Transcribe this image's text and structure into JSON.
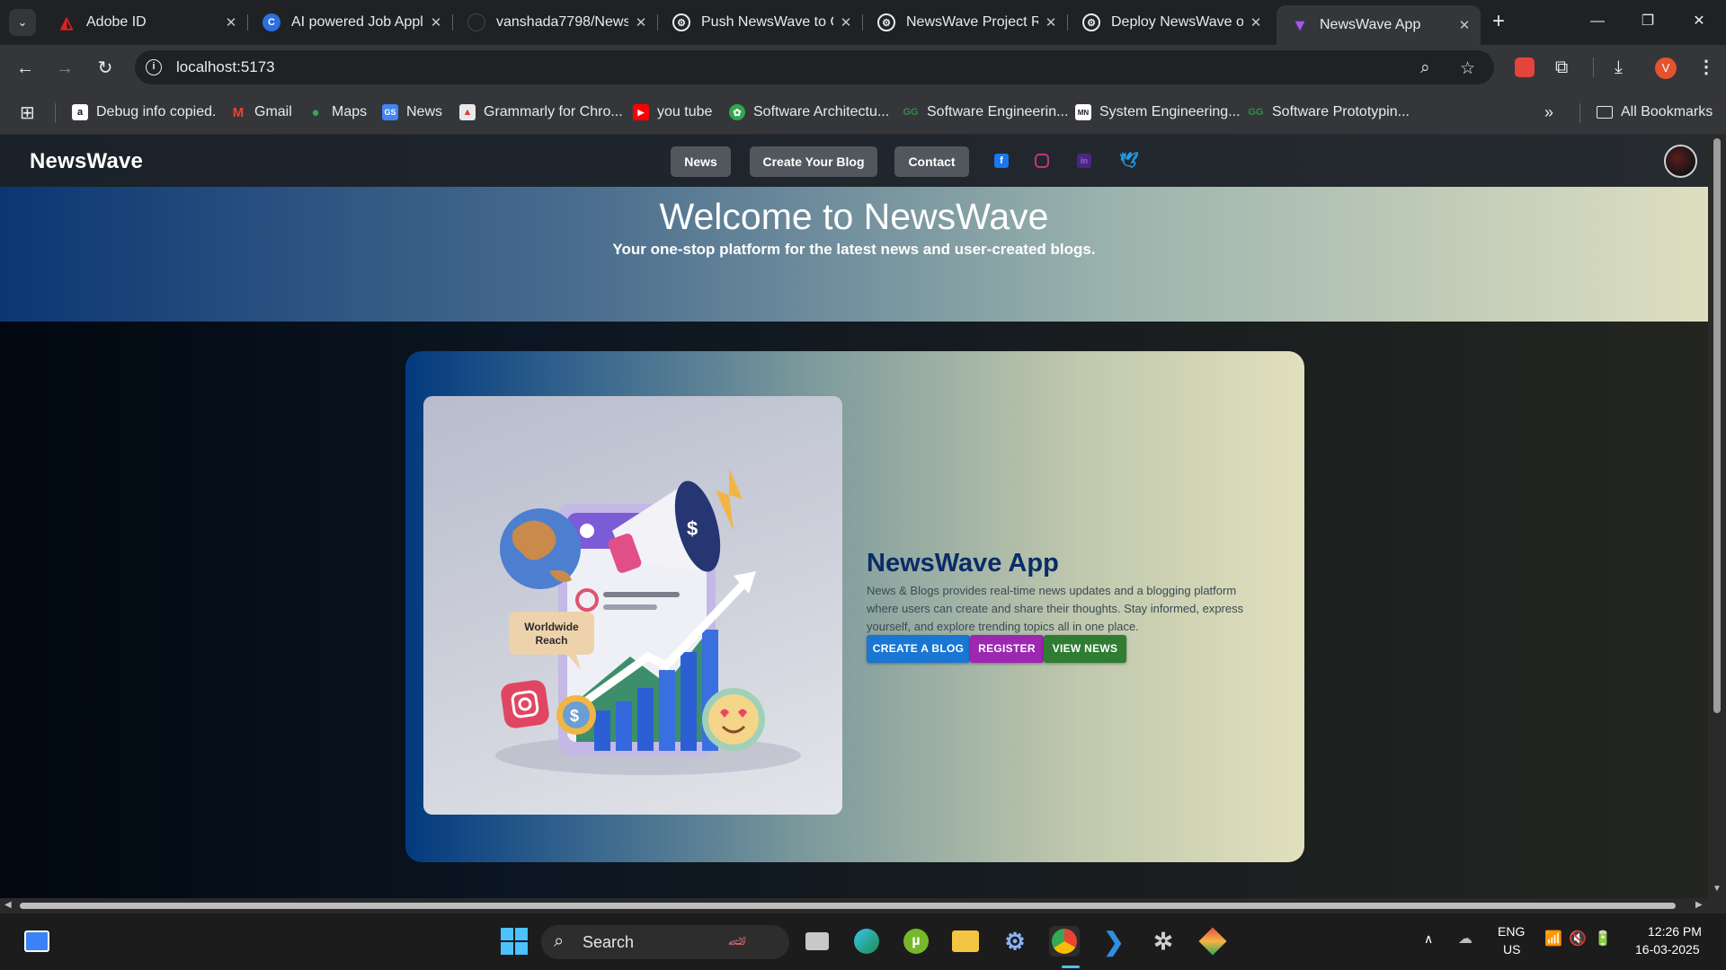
{
  "browser": {
    "tabs": [
      {
        "title": "Adobe ID",
        "icon": "adobe-icon",
        "color": "#e0211f"
      },
      {
        "title": "AI powered Job Appl",
        "icon": "c-logo-icon",
        "color": "#2d6ee0"
      },
      {
        "title": "vanshada7798/News",
        "icon": "github-icon",
        "color": "#202124"
      },
      {
        "title": "Push NewsWave to G",
        "icon": "chatgpt-icon",
        "color": "#e8eaed"
      },
      {
        "title": "NewsWave Project Re",
        "icon": "chatgpt-icon",
        "color": "#e8eaed"
      },
      {
        "title": "Deploy NewsWave o",
        "icon": "chatgpt-icon",
        "color": "#e8eaed"
      },
      {
        "title": "NewsWave App",
        "icon": "vite-icon",
        "color": "#a855f7",
        "active": true
      }
    ],
    "address": "localhost:5173",
    "profile_initial": "V",
    "bookmarks": [
      {
        "label": "Debug info copied.",
        "icon": "amazon-icon",
        "color": "#ffffff"
      },
      {
        "label": "Gmail",
        "icon": "gmail-icon",
        "color": "#ea4335"
      },
      {
        "label": "Maps",
        "icon": "maps-icon",
        "color": "#34a853"
      },
      {
        "label": "News",
        "icon": "google-news-icon",
        "color": "#4285f4"
      },
      {
        "label": "Grammarly for Chro...",
        "icon": "grammarly-icon",
        "color": "#15c39a"
      },
      {
        "label": "you tube",
        "icon": "youtube-icon",
        "color": "#ff0000"
      },
      {
        "label": "Software Architectu...",
        "icon": "leaf-icon",
        "color": "#2fa84f"
      },
      {
        "label": "Software Engineerin...",
        "icon": "gfg-icon",
        "color": "#2f8d46"
      },
      {
        "label": "System Engineering...",
        "icon": "doc-icon",
        "color": "#ffffff"
      },
      {
        "label": "Software Prototypin...",
        "icon": "gfg-icon",
        "color": "#2f8d46"
      }
    ],
    "all_bookmarks": "All Bookmarks"
  },
  "site": {
    "brand": "NewsWave",
    "nav": [
      "News",
      "Create Your Blog",
      "Contact"
    ],
    "social": [
      {
        "icon": "facebook-icon",
        "color": "#1877f2"
      },
      {
        "icon": "instagram-icon",
        "color": "#c13584"
      },
      {
        "icon": "linkedin-icon",
        "color": "#6a2fa8"
      },
      {
        "icon": "twitter-icon",
        "color": "#1da1f2"
      }
    ],
    "hero": {
      "title": "Welcome to NewsWave",
      "subtitle": "Your one-stop platform for the latest news and user-created blogs."
    },
    "card": {
      "title": "NewsWave App",
      "description": "News & Blogs provides real-time news updates and a blogging platform where users can create and share their thoughts. Stay informed, express yourself, and explore trending topics all in one place.",
      "illustration_label": "Worldwide Reach",
      "buttons": [
        {
          "label": "CREATE A BLOG",
          "color": "#1976d2"
        },
        {
          "label": "REGISTER",
          "color": "#9c27b0"
        },
        {
          "label": "VIEW NEWS",
          "color": "#2e7d32"
        }
      ]
    }
  },
  "taskbar": {
    "search_label": "Search",
    "lang_1": "ENG",
    "lang_2": "US",
    "time": "12:26 PM",
    "date": "16-03-2025"
  }
}
